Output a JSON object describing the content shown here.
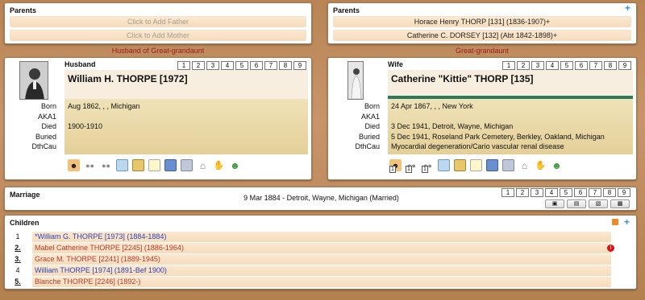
{
  "parents_left": {
    "title": "Parents",
    "father_placeholder": "Click to Add Father",
    "mother_placeholder": "Click to Add Mother",
    "relation": "Husband of Great-grandaunt"
  },
  "parents_right": {
    "title": "Parents",
    "father": "Horace Henry THORP [131] (1836-1907)+",
    "mother": "Catherine C. DORSEY [132] (Abt 1842-1898)+",
    "relation": "Great-grandaunt"
  },
  "tab_numbers": [
    "1",
    "2",
    "3",
    "4",
    "5",
    "6",
    "7",
    "8",
    "9"
  ],
  "husband": {
    "role": "Husband",
    "name": "William H. THORPE [1972]",
    "fact_labels": [
      "Born",
      "AKA1",
      "Died",
      "Buried",
      "DthCau"
    ],
    "fact_values": [
      "Aug 1862, , , Michigan",
      "",
      "1900-1910",
      "",
      ""
    ],
    "icons": [
      "person-add-icon",
      "group-icon",
      "group-icon",
      "notes-icon",
      "media-icon",
      "document-icon",
      "book-icon",
      "source-icon",
      "house-icon",
      "hand-icon",
      "user-icon"
    ]
  },
  "wife": {
    "role": "Wife",
    "name": "Catherine \"Kittie\" THORP [135]",
    "fact_labels": [
      "Born",
      "AKA1",
      "Died",
      "Buried",
      "DthCau"
    ],
    "fact_values": [
      "24 Apr 1867, , , New York",
      "",
      "3 Dec 1941, Detroit, Wayne, Michigan",
      "5 Dec 1941, Roseland Park Cemetery, Berkley, Oakland, Michigan",
      "Myocardial degeneration/Cario vascular renal disease"
    ],
    "icon_badges": [
      "1",
      "1",
      "1"
    ]
  },
  "marriage": {
    "title": "Marriage",
    "text": "9 Mar 1884 - Detroit, Wayne, Michigan (Married)",
    "tab_numbers": [
      "1",
      "2",
      "3",
      "4",
      "5",
      "6",
      "7",
      "8",
      "9"
    ]
  },
  "children": {
    "title": "Children",
    "items": [
      {
        "num": "1",
        "name": "*William G. THORPE [1973] (1884-1884)"
      },
      {
        "num": "2.",
        "name": "Mabel Catherine THORPE [2245] (1886-1964)"
      },
      {
        "num": "3.",
        "name": "Grace M. THORPE [2241] (1889-1945)"
      },
      {
        "num": "4",
        "name": "William THORPE [1974] (1891-Bef 1900)"
      },
      {
        "num": "5.",
        "name": "Blanche THORPE [2246] (1892-)"
      }
    ],
    "alert_label": "!"
  },
  "colors": {
    "male": "#2a3fb8",
    "female": "#b43a2a",
    "relation": "#9b1b1b",
    "background": "#c08b5e"
  }
}
